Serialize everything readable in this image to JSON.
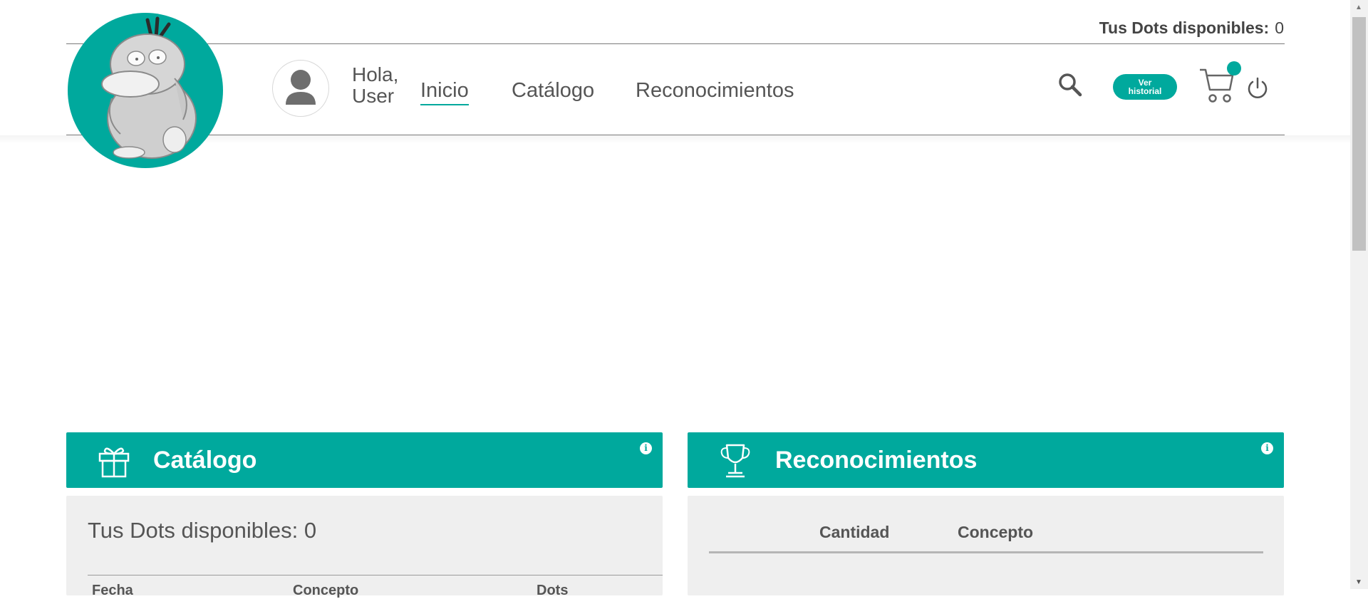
{
  "header": {
    "dots_label": "Tus Dots disponibles:",
    "dots_value": "0",
    "greeting_line1": "Hola,",
    "greeting_line2": "User",
    "nav": [
      {
        "label": "Inicio",
        "active": true
      },
      {
        "label": "Catálogo",
        "active": false
      },
      {
        "label": "Reconocimientos",
        "active": false
      }
    ],
    "history_button_line1": "Ver",
    "history_button_line2": "historial",
    "icons": [
      "search-icon",
      "cart-icon",
      "power-icon",
      "user-avatar-icon"
    ]
  },
  "colors": {
    "accent": "#00a99d",
    "panel_bg": "#efefef",
    "text": "#4a4a4a"
  },
  "catalog": {
    "title": "Catálogo",
    "dots_text": "Tus Dots disponibles: 0",
    "columns": [
      "Fecha",
      "Concepto",
      "Dots"
    ],
    "icon": "gift-icon"
  },
  "recognitions": {
    "title": "Reconocimientos",
    "columns": [
      "Cantidad",
      "Concepto"
    ],
    "icon": "trophy-icon"
  }
}
